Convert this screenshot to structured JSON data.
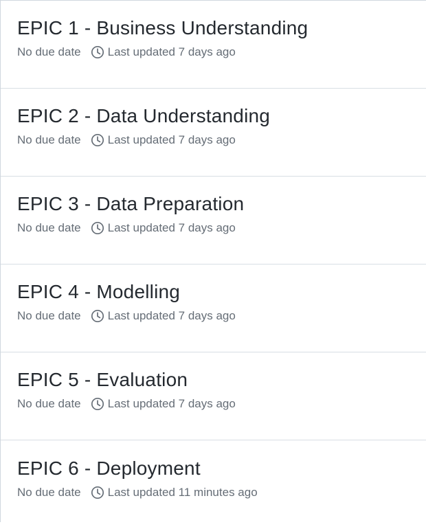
{
  "milestones": [
    {
      "title": "EPIC 1 - Business Understanding",
      "due": "No due date",
      "updated": "Last updated 7 days ago",
      "icon": "clock-icon"
    },
    {
      "title": "EPIC 2 - Data Understanding",
      "due": "No due date",
      "updated": "Last updated 7 days ago",
      "icon": "clock-icon"
    },
    {
      "title": "EPIC 3 - Data Preparation",
      "due": "No due date",
      "updated": "Last updated 7 days ago",
      "icon": "clock-icon"
    },
    {
      "title": "EPIC 4 - Modelling",
      "due": "No due date",
      "updated": "Last updated 7 days ago",
      "icon": "clock-icon"
    },
    {
      "title": "EPIC 5 - Evaluation",
      "due": "No due date",
      "updated": "Last updated 7 days ago",
      "icon": "clock-icon"
    },
    {
      "title": "EPIC 6 - Deployment",
      "due": "No due date",
      "updated": "Last updated 11 minutes ago",
      "icon": "clock-icon"
    }
  ]
}
